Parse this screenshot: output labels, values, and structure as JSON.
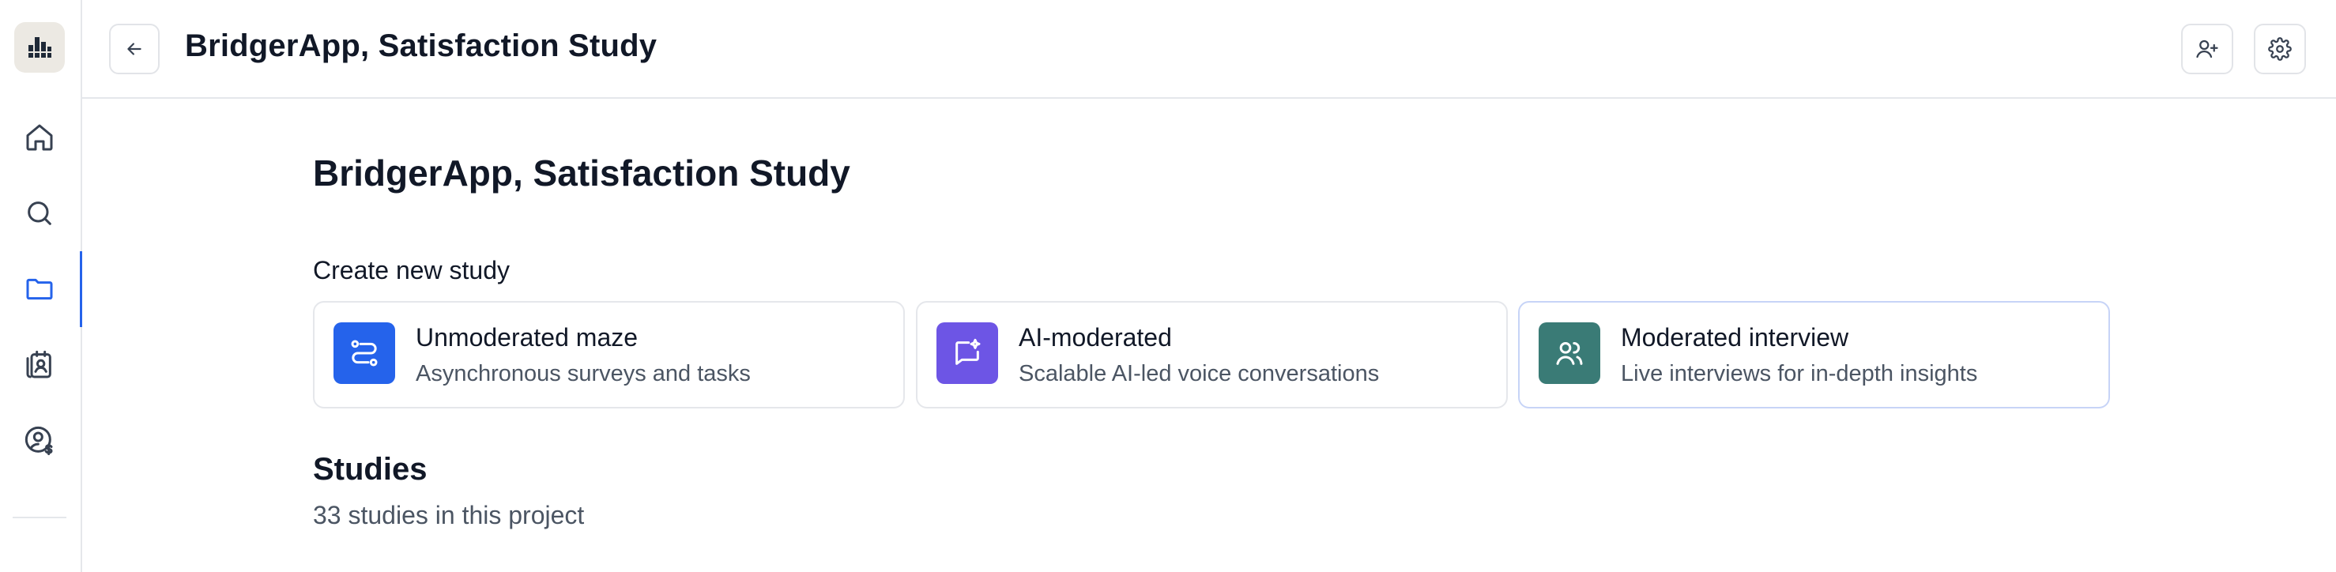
{
  "sidebar": {
    "logo_icon": "bar-logo-icon",
    "items": [
      {
        "name": "home",
        "icon": "home-icon"
      },
      {
        "name": "search",
        "icon": "search-icon"
      },
      {
        "name": "projects",
        "icon": "folder-icon",
        "active": true
      },
      {
        "name": "participants",
        "icon": "contacts-icon"
      },
      {
        "name": "billing",
        "icon": "user-dollar-icon"
      }
    ],
    "active_color": "#2563eb"
  },
  "header": {
    "title": "BridgerApp, Satisfaction Study",
    "back_icon": "arrow-left-icon",
    "actions": [
      {
        "name": "invite",
        "icon": "user-plus-icon"
      },
      {
        "name": "settings",
        "icon": "gear-icon"
      }
    ]
  },
  "main": {
    "title": "BridgerApp, Satisfaction Study",
    "create_label": "Create new study",
    "study_types": [
      {
        "title": "Unmoderated maze",
        "subtitle": "Asynchronous surveys and tasks",
        "icon": "route-icon",
        "color": "#2563eb"
      },
      {
        "title": "AI-moderated",
        "subtitle": "Scalable AI-led voice conversations",
        "icon": "chat-sparkle-icon",
        "color": "#6d55e5"
      },
      {
        "title": "Moderated interview",
        "subtitle": "Live interviews for in-depth insights",
        "icon": "users-icon",
        "color": "#3a7b76"
      }
    ],
    "studies_title": "Studies",
    "studies_count": "33 studies in this project"
  }
}
